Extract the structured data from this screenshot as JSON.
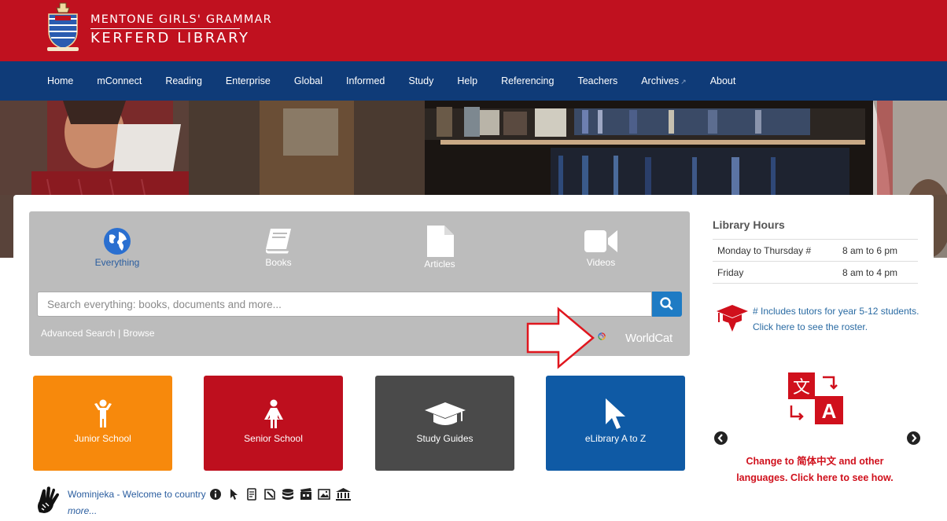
{
  "header": {
    "school": "MENTONE GIRLS' GRAMMAR",
    "library": "KERFERD LIBRARY",
    "brand_color": "#c0111f"
  },
  "nav": {
    "color": "#0f3b78",
    "items": [
      {
        "label": "Home"
      },
      {
        "label": "mConnect"
      },
      {
        "label": "Reading"
      },
      {
        "label": "Enterprise"
      },
      {
        "label": "Global"
      },
      {
        "label": "Informed"
      },
      {
        "label": "Study"
      },
      {
        "label": "Help"
      },
      {
        "label": "Referencing"
      },
      {
        "label": "Teachers"
      },
      {
        "label": "Archives",
        "external": true
      },
      {
        "label": "About"
      }
    ]
  },
  "search": {
    "types": [
      {
        "label": "Everything",
        "icon": "globe-icon",
        "active": true
      },
      {
        "label": "Books",
        "icon": "book-icon"
      },
      {
        "label": "Articles",
        "icon": "file-icon"
      },
      {
        "label": "Videos",
        "icon": "video-camera-icon"
      }
    ],
    "placeholder": "Search everything: books, documents and more...",
    "advanced": "Advanced Search",
    "separator": " | ",
    "browse": "Browse",
    "provider": "WorldCat"
  },
  "tiles": [
    {
      "label": "Junior School",
      "color": "#f7890c",
      "icon": "child-icon"
    },
    {
      "label": "Senior School",
      "color": "#be0f1e",
      "icon": "female-icon"
    },
    {
      "label": "Study Guides",
      "color": "#4a4a4a",
      "icon": "graduation-cap-icon"
    },
    {
      "label": "eLibrary A to Z",
      "color": "#0f5aa5",
      "icon": "cursor-icon"
    }
  ],
  "acknowledgement": {
    "text": "Wominjeka - Welcome to country",
    "more": "more..."
  },
  "hours": {
    "title": "Library Hours",
    "rows": [
      {
        "day": "Monday to Thursday #",
        "time": "8 am to 6 pm"
      },
      {
        "day": "Friday",
        "time": "8 am to 4 pm"
      }
    ]
  },
  "tutor": {
    "text": "# Includes tutors for year 5-12 students. Click here to see the roster."
  },
  "language": {
    "text": "Change to 简体中文 and other languages. Click here to see how."
  }
}
